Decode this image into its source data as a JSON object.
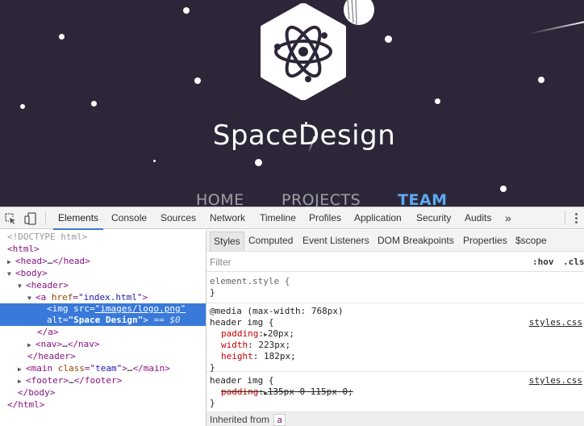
{
  "site": {
    "brand": "SpaceDesign",
    "nav": [
      "HOME",
      "PROJECTS",
      "TEAM"
    ],
    "active_nav": "TEAM",
    "colors": {
      "background": "#2d2638",
      "accent": "#5aaaf2"
    },
    "logo_icon": "atom-icon"
  },
  "devtools": {
    "tabs": [
      "Elements",
      "Console",
      "Sources",
      "Network",
      "Timeline",
      "Profiles",
      "Application",
      "Security",
      "Audits"
    ],
    "active_tab": "Elements",
    "more": "»",
    "dom": {
      "l1": "<!DOCTYPE html>",
      "html_open": "<html>",
      "head_open": "<head>",
      "ellipsis": "…",
      "head_close": "</head>",
      "body_open": "<body>",
      "header_open": "<header>",
      "a_open": "<a",
      "href_attr": "href",
      "href_val": "\"index.html\"",
      "gt": ">",
      "img_open": "<img",
      "src_attr": "src",
      "src_val": "\"images/logo.png\"",
      "alt_attr": "alt",
      "alt_val": "\"Space Design\"",
      "img_close": ">",
      "eq_marker": "== $0",
      "a_close": "</a>",
      "nav_open": "<nav>",
      "nav_close": "</nav>",
      "header_close": "</header>",
      "main_open": "<main",
      "class_attr": "class",
      "class_val": "\"team\"",
      "main_close": "</main>",
      "footer_open": "<footer>",
      "footer_close": "</footer>",
      "body_close": "</body>",
      "html_close": "</html>",
      "gutter": "••"
    },
    "styles": {
      "subtabs": [
        "Styles",
        "Computed",
        "Event Listeners",
        "DOM Breakpoints",
        "Properties",
        "$scope"
      ],
      "active_subtab": "Styles",
      "filter_placeholder": "Filter",
      "hov": ":hov",
      "cls": ".cls",
      "element_style": "element.style {",
      "close_brace": "}",
      "media": "@media (max-width: 768px)",
      "selector": "header img {",
      "source": "styles.css",
      "rule2": [
        {
          "name": "padding",
          "value": "20px;"
        },
        {
          "name": "width",
          "value": "223px;"
        },
        {
          "name": "height",
          "value": "182px;"
        }
      ],
      "rule3": {
        "name": "padding",
        "value": "135px 0 115px 0;"
      },
      "inherited_label": "Inherited from",
      "inherited_tag": "a"
    }
  }
}
